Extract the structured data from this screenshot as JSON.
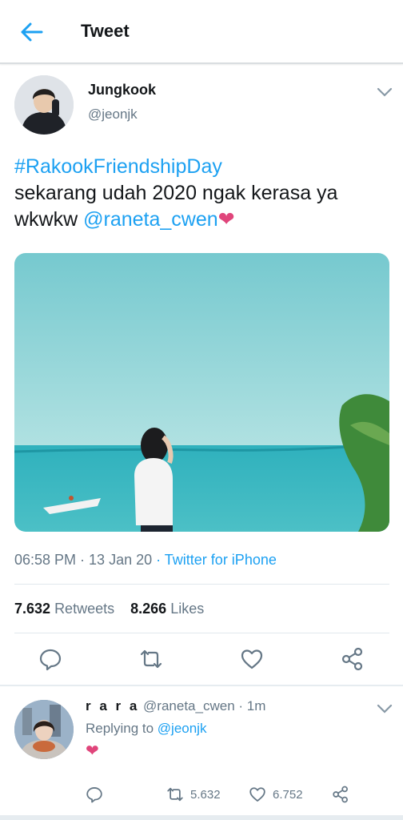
{
  "header": {
    "title": "Tweet",
    "back_icon": "arrow-left-icon"
  },
  "tweet": {
    "author_name": "Jungkook",
    "author_handle": "@jeonjk",
    "hashtag": "#RakookFriendshipDay",
    "text_line2": "sekarang udah 2020 ngak kerasa ya",
    "text_line3_prefix": "wkwkw ",
    "mention": "@raneta_cwen",
    "emoji": "❤",
    "time": "06:58 PM",
    "date": "13 Jan 20",
    "separator": " · ",
    "source": "Twitter for iPhone",
    "retweets_count": "7.632",
    "retweets_label": "Retweets",
    "likes_count": "8.266",
    "likes_label": "Likes"
  },
  "reply": {
    "name": "r a r a",
    "handle": "@raneta_cwen",
    "age": "1m",
    "replying_to_label": "Replying to ",
    "replying_to": "@jeonjk",
    "emoji": "❤",
    "retweets": "5.632",
    "likes": "6.752"
  },
  "colors": {
    "accent": "#1da1f2",
    "heart": "#e0457b",
    "muted": "#657786"
  }
}
